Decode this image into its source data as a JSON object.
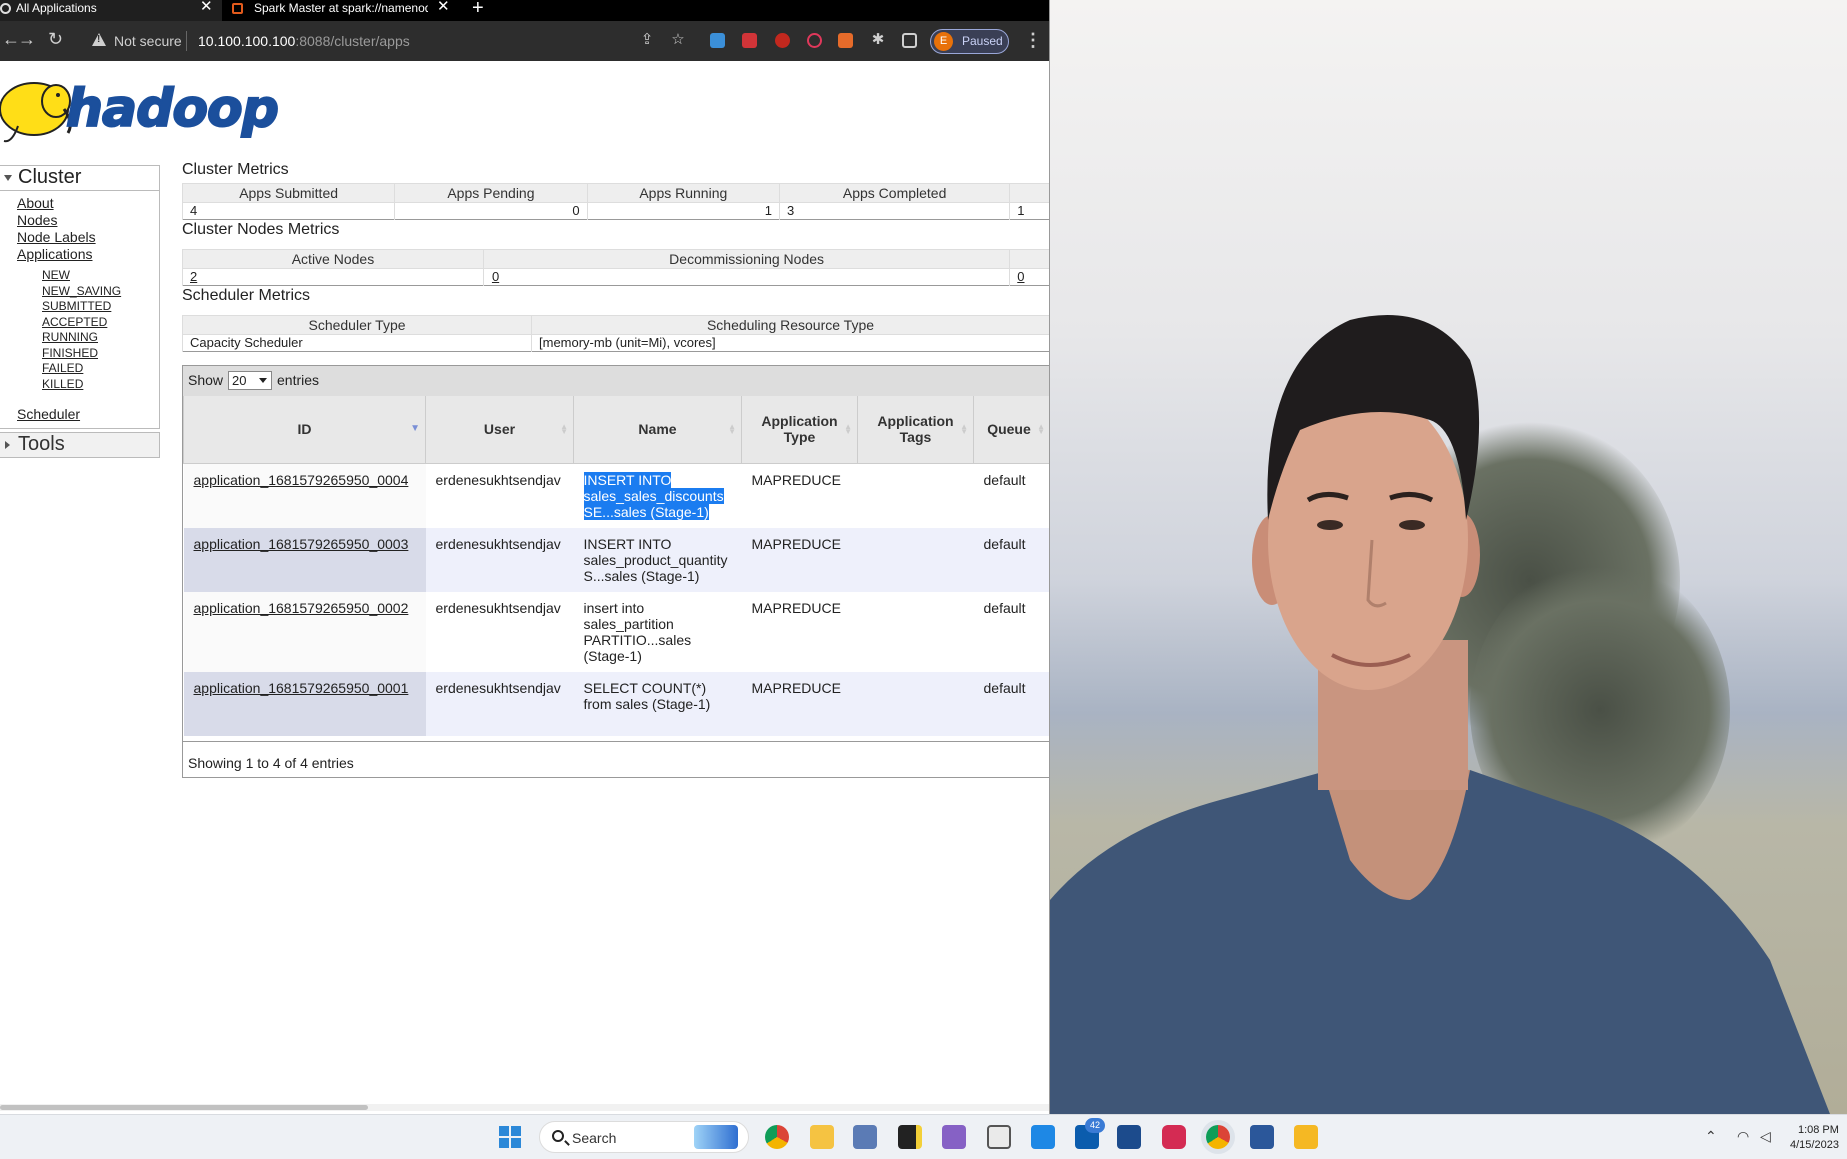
{
  "browser": {
    "tabs": [
      {
        "title": "All Applications",
        "active": true
      },
      {
        "title": "Spark Master at spark://namenod",
        "active": false
      }
    ],
    "security_label": "Not secure",
    "url_host": "10.100.100.100",
    "url_rest": ":8088/cluster/apps",
    "profile_initial": "E",
    "profile_status": "Paused"
  },
  "logo": {
    "text": "hadoop"
  },
  "sidebar": {
    "cluster_header": "Cluster",
    "links": [
      "About",
      "Nodes",
      "Node Labels",
      "Applications"
    ],
    "app_states": [
      "NEW",
      "NEW_SAVING",
      "SUBMITTED",
      "ACCEPTED",
      "RUNNING",
      "FINISHED",
      "FAILED",
      "KILLED"
    ],
    "scheduler": "Scheduler",
    "tools_header": "Tools"
  },
  "cluster_metrics": {
    "title": "Cluster Metrics",
    "headers": [
      "Apps Submitted",
      "Apps Pending",
      "Apps Running",
      "Apps Completed"
    ],
    "values": [
      "4",
      "0",
      "1",
      "3",
      "1"
    ]
  },
  "node_metrics": {
    "title": "Cluster Nodes Metrics",
    "headers": [
      "Active Nodes",
      "Decommissioning Nodes"
    ],
    "values": [
      "2",
      "0",
      "0"
    ]
  },
  "scheduler_metrics": {
    "title": "Scheduler Metrics",
    "headers": [
      "Scheduler Type",
      "Scheduling Resource Type"
    ],
    "values": [
      "Capacity Scheduler",
      "[memory-mb (unit=Mi), vcores]"
    ]
  },
  "apps_table": {
    "show_label": "Show",
    "page_size": "20",
    "entries_label": "entries",
    "headers": {
      "id": "ID",
      "user": "User",
      "name": "Name",
      "type": "Application Type",
      "tags": "Application Tags",
      "queue": "Queue"
    },
    "rows": [
      {
        "id": "application_1681579265950_0004",
        "user": "erdenesukhtsendjav",
        "name": [
          "INSERT INTO",
          "sales_sales_discounts",
          "SE...sales (Stage-1)"
        ],
        "type": "MAPREDUCE",
        "tags": "",
        "queue": "default"
      },
      {
        "id": "application_1681579265950_0003",
        "user": "erdenesukhtsendjav",
        "name": [
          "INSERT INTO",
          "sales_product_quantity",
          "S...sales (Stage-1)"
        ],
        "type": "MAPREDUCE",
        "tags": "",
        "queue": "default"
      },
      {
        "id": "application_1681579265950_0002",
        "user": "erdenesukhtsendjav",
        "name": [
          "insert into",
          "sales_partition",
          "PARTITIO...sales",
          "(Stage-1)"
        ],
        "type": "MAPREDUCE",
        "tags": "",
        "queue": "default"
      },
      {
        "id": "application_1681579265950_0001",
        "user": "erdenesukhtsendjav",
        "name": [
          "SELECT COUNT(*)",
          "from sales (Stage-1)"
        ],
        "type": "MAPREDUCE",
        "tags": "",
        "queue": "default"
      }
    ],
    "footer": "Showing 1 to 4 of 4 entries"
  },
  "taskbar": {
    "search_placeholder": "Search",
    "badge_count": "42",
    "time": "1:08 PM",
    "date": "4/15/2023"
  },
  "colors": {
    "hadoop_blue": "#1b4f9c",
    "selection": "#1b7cf0",
    "taskbar": "#eef1f5"
  }
}
